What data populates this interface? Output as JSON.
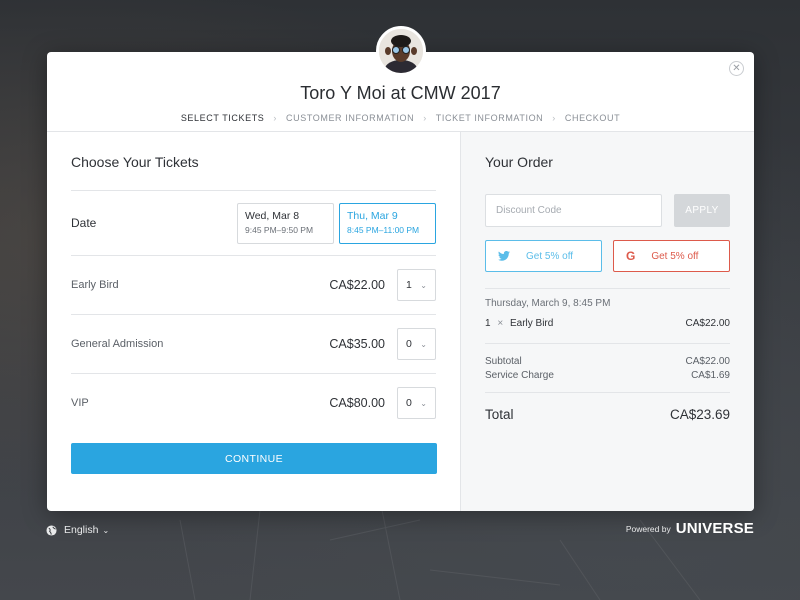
{
  "event": {
    "title": "Toro Y Moi at CMW 2017",
    "steps": [
      "SELECT TICKETS",
      "CUSTOMER INFORMATION",
      "TICKET INFORMATION",
      "CHECKOUT"
    ]
  },
  "tickets_panel": {
    "title": "Choose Your Tickets",
    "date_label": "Date",
    "dates": [
      {
        "day": "Wed, Mar 8",
        "time": "9:45 PM–9:50 PM",
        "selected": false
      },
      {
        "day": "Thu, Mar 9",
        "time": "8:45 PM–11:00 PM",
        "selected": true
      }
    ],
    "tickets": [
      {
        "name": "Early Bird",
        "price": "CA$22.00",
        "qty": "1"
      },
      {
        "name": "General Admission",
        "price": "CA$35.00",
        "qty": "0"
      },
      {
        "name": "VIP",
        "price": "CA$80.00",
        "qty": "0"
      }
    ],
    "continue_label": "CONTINUE"
  },
  "order": {
    "title": "Your Order",
    "discount_placeholder": "Discount Code",
    "apply_label": "APPLY",
    "twitter_label": "Get 5% off",
    "google_label": "Get 5% off",
    "date_line": "Thursday, March 9, 8:45 PM",
    "item": {
      "qty": "1",
      "times": "×",
      "name": "Early Bird",
      "price": "CA$22.00"
    },
    "subtotal_label": "Subtotal",
    "subtotal_value": "CA$22.00",
    "service_label": "Service Charge",
    "service_value": "CA$1.69",
    "total_label": "Total",
    "total_value": "CA$23.69"
  },
  "footer": {
    "language": "English",
    "powered_by": "Powered by",
    "brand": "UNIVERSE"
  },
  "colors": {
    "accent": "#2aa5e0",
    "twitter": "#5bbde9",
    "google": "#dd5a4b"
  }
}
